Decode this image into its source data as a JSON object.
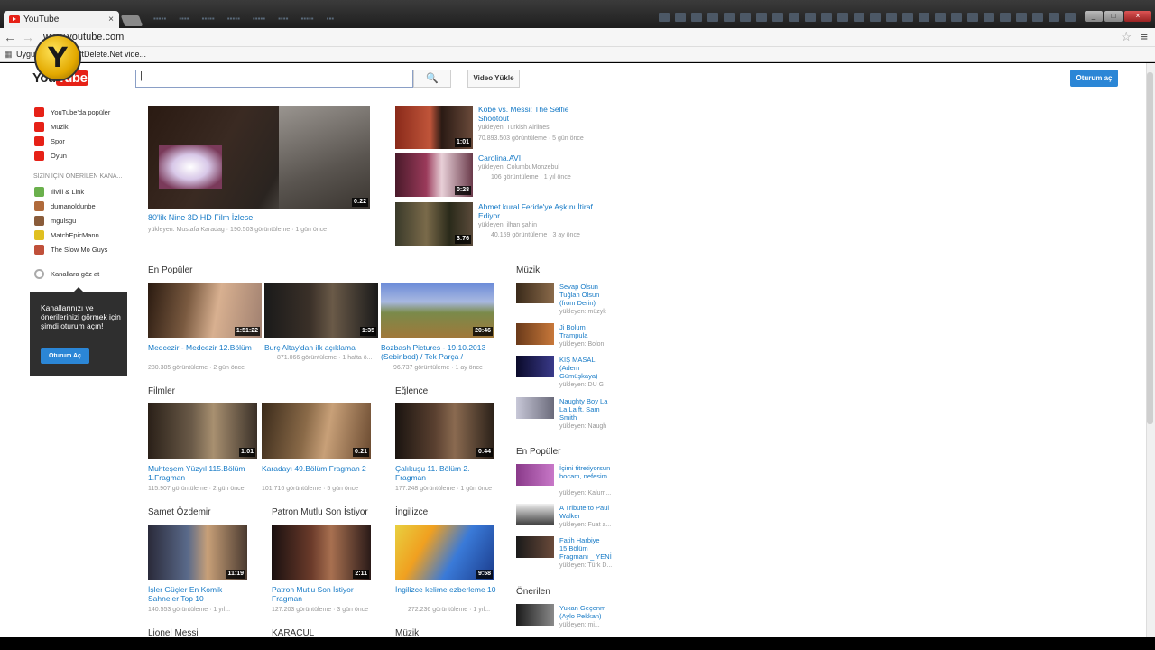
{
  "browser": {
    "tab_title": "YouTube",
    "tab_close": "×",
    "url": "www.youtube.com",
    "bookmarks": [
      "Uygu",
      "ftDelete.Net vide..."
    ],
    "star": "☆",
    "menu": "≡",
    "back": "←",
    "forward": "→",
    "apps": "▦",
    "overlay_logo": "Y"
  },
  "header": {
    "logo_prefix": "You",
    "logo_suffix": "Tube",
    "search_icon": "🔍",
    "upload_label": "Video Yükle",
    "signin_label": "Oturum aç"
  },
  "guide": {
    "items": [
      {
        "label": "YouTube'da popüler",
        "color": "#e62117"
      },
      {
        "label": "Müzik",
        "color": "#e62117"
      },
      {
        "label": "Spor",
        "color": "#e62117"
      },
      {
        "label": "Oyun",
        "color": "#e62117"
      }
    ],
    "heading": "SİZİN İÇİN ÖNERİLEN KANA...",
    "channels": [
      {
        "label": "Illvill & Link",
        "color": "#6ab04c"
      },
      {
        "label": "dumanoldunbe",
        "color": "#b06a3b"
      },
      {
        "label": "mgulsgu",
        "color": "#8a5c3a"
      },
      {
        "label": "MatchEpicMann",
        "color": "#e0c020"
      },
      {
        "label": "The Slow Mo Guys",
        "color": "#c0503a"
      }
    ],
    "browse_channels": "Kanallara göz at",
    "promo_text": "Kanallarınızı ve önerilerinizi görmek için şimdi oturum açın!",
    "promo_button": "Oturum Aç"
  },
  "featured": {
    "main": {
      "title": "80'lik Nine 3D HD Film İzlese",
      "meta": "yükleyen: Mustafa Karadag · 190.503 görüntüleme · 1 gün önce",
      "duration": "0:22"
    },
    "side": [
      {
        "title": "Kobe vs. Messi: The Selfie Shootout",
        "meta1": "yükleyen: Turkish Airlines",
        "meta2": "70.893.503 görüntüleme · 5 gün önce",
        "duration": "1:01"
      },
      {
        "title": "Carolina.AVI",
        "meta1": "yükleyen: ColumbuMonzebul",
        "meta2": "106 görüntüleme · 1 yıl önce",
        "duration": "0:28"
      },
      {
        "title": "Ahmet kural Feride'ye Aşkını İtiraf Ediyor",
        "meta1": "yükleyen: ilhan şahin",
        "meta2": "40.159 görüntüleme · 3 ay önce",
        "duration": "3:76"
      }
    ]
  },
  "shelves": {
    "popular": {
      "title": "En Popüler",
      "videos": [
        {
          "title": "Medcezir - Medcezir 12.Bölüm",
          "meta": "280.385 görüntüleme · 2 gün önce",
          "duration": "1:51:22"
        },
        {
          "title": "Burç Altay'dan ilk açıklama",
          "meta": "871.066 görüntüleme · 1 hafta ö...",
          "duration": "1:35"
        },
        {
          "title": "Bozbash Pictures - 19.10.2013 (Sebinbod) / Tek Parça /",
          "meta": "96.737 görüntüleme · 1 ay önce",
          "duration": "20:46"
        }
      ]
    },
    "films": {
      "title": "Filmler",
      "videos": [
        {
          "title": "Muhteşem Yüzyıl 115.Bölüm 1.Fragman",
          "meta": "115.907 görüntüleme · 2 gün önce",
          "duration": "1:01"
        },
        {
          "title": "Karadayı 49.Bölüm Fragman 2",
          "meta": "101.716 görüntüleme · 5 gün önce",
          "duration": "0:21"
        }
      ]
    },
    "entertainment": {
      "title": "Eğlence",
      "videos": [
        {
          "title": "Çalıkuşu 11. Bölüm 2. Fragman",
          "meta": "177.248 görüntüleme · 1 gün önce",
          "duration": "0:44"
        }
      ]
    },
    "samet": {
      "title": "Samet Özdemir",
      "videos": [
        {
          "title": "İşler Güçler En Komik Sahneler Top 10",
          "meta": "140.553 görüntüleme · 1 yıl...",
          "duration": "11:19"
        }
      ]
    },
    "patron": {
      "title": "Patron Mutlu Son İstiyor",
      "videos": [
        {
          "title": "Patron Mutlu Son İstiyor Fragman",
          "meta": "127.203 görüntüleme · 3 gün önce",
          "duration": "2:11"
        }
      ]
    },
    "english": {
      "title": "İngilizce",
      "videos": [
        {
          "title": "İngilizce kelime ezberleme 10",
          "meta": "272.236 görüntüleme · 1 yıl...",
          "duration": "9:58"
        }
      ]
    },
    "row4_titles": [
      "Lionel Messi",
      "KARACUL",
      "Müzik"
    ]
  },
  "right": {
    "music": {
      "title": "Müzik",
      "items": [
        {
          "title": "Sevap Olsun Tuğlan Olsun (from Derin)",
          "meta": "yükleyen: müzyk"
        },
        {
          "title": "Ji Bolum Trampula",
          "meta": "yükleyen: Bolon"
        },
        {
          "title": "KIŞ MASALI (Adem Gümüşkaya)",
          "meta": "yükleyen: DU G"
        },
        {
          "title": "Naughty Boy La La La ft. Sam Smith",
          "meta": "yükleyen: Naugh"
        }
      ]
    },
    "popular": {
      "title": "En Popüler",
      "items": [
        {
          "title": "İçimi titretiyorsun hocam, nefesim",
          "meta": "yükleyen: Kalum..."
        },
        {
          "title": "A Tribute to Paul Walker",
          "meta": "yükleyen: Fuat a..."
        },
        {
          "title": "Fatih Harbiye 15.Bölüm Fragmanı _ YENİ",
          "meta": "yükleyen: Türk D..."
        }
      ]
    },
    "recommended": {
      "title": "Önerilen",
      "items": [
        {
          "title": "Yukan Geçenm (Aylo Pekkan)",
          "meta": "yükleyen: mi..."
        }
      ]
    }
  }
}
